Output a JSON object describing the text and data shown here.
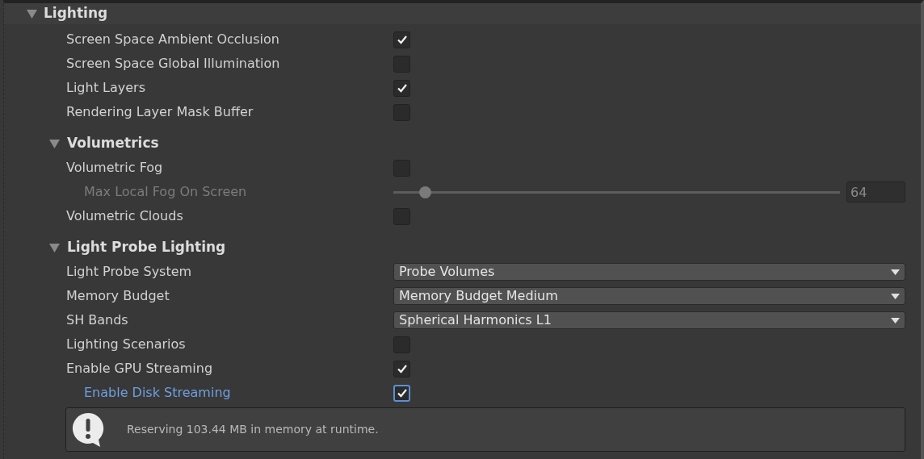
{
  "sections": [
    {
      "title": "Lighting",
      "expanded": true,
      "items": [
        {
          "kind": "checkbox",
          "label": "Screen Space Ambient Occlusion",
          "checked": true
        },
        {
          "kind": "checkbox",
          "label": "Screen Space Global Illumination",
          "checked": false
        },
        {
          "kind": "checkbox",
          "label": "Light Layers",
          "checked": true
        },
        {
          "kind": "checkbox",
          "label": "Rendering Layer Mask Buffer",
          "checked": false
        }
      ],
      "subsections": [
        {
          "title": "Volumetrics",
          "expanded": true,
          "items": [
            {
              "kind": "checkbox",
              "label": "Volumetric Fog",
              "checked": false,
              "children": [
                {
                  "kind": "slider",
                  "label": "Max Local Fog On Screen",
                  "disabled": true,
                  "level": 0.07,
                  "value": "64"
                }
              ]
            },
            {
              "kind": "checkbox",
              "label": "Volumetric Clouds",
              "checked": false
            }
          ]
        },
        {
          "title": "Light Probe Lighting",
          "expanded": true,
          "items": [
            {
              "kind": "dropdown",
              "label": "Light Probe System",
              "value": "Probe Volumes"
            },
            {
              "kind": "dropdown",
              "label": "Memory Budget",
              "value": "Memory Budget Medium"
            },
            {
              "kind": "dropdown",
              "label": "SH Bands",
              "value": "Spherical Harmonics L1"
            },
            {
              "kind": "checkbox",
              "label": "Lighting Scenarios",
              "checked": false
            },
            {
              "kind": "checkbox",
              "label": "Enable GPU Streaming",
              "checked": true,
              "children": [
                {
                  "kind": "checkbox",
                  "label": "Enable Disk Streaming",
                  "checked": true,
                  "highlighted": true
                }
              ]
            }
          ],
          "help": {
            "kind": "info",
            "text": "Reserving 103.44 MB in memory at runtime."
          }
        }
      ]
    }
  ]
}
